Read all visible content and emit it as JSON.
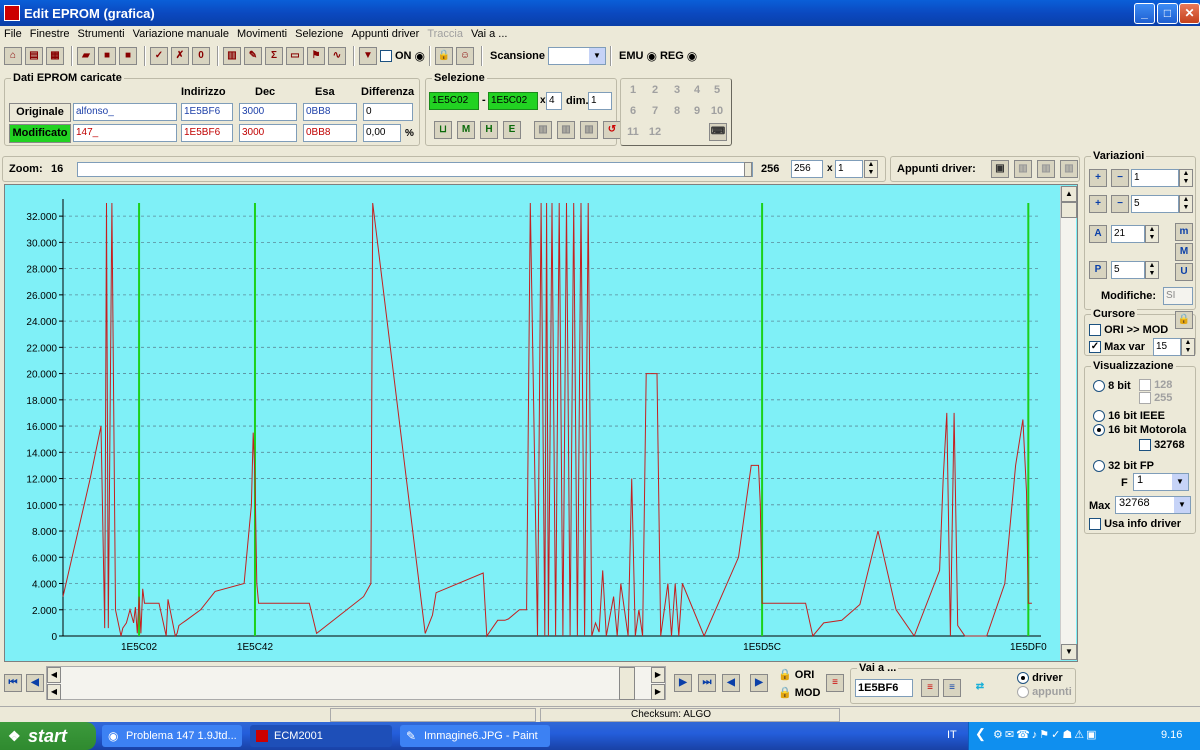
{
  "window": {
    "title": "Edit EPROM (grafica)"
  },
  "menu": [
    "File",
    "Finestre",
    "Strumenti",
    "Variazione manuale",
    "Movimenti",
    "Selezione",
    "Appunti driver",
    "Traccia",
    "Vai a ..."
  ],
  "toolbar": {
    "on_label": "ON",
    "scansione_label": "Scansione",
    "emu_label": "EMU",
    "reg_label": "REG"
  },
  "dati": {
    "title": "Dati EPROM caricate",
    "col_indirizzo": "Indirizzo",
    "col_dec": "Dec",
    "col_esa": "Esa",
    "col_diff": "Differenza",
    "originale_label": "Originale",
    "modificato_label": "Modificato",
    "orig_name": "alfonso_",
    "orig_addr": "1E5BF6",
    "orig_dec": "3000",
    "orig_esa": "0BB8",
    "orig_diff": "0",
    "mod_name": "147_",
    "mod_addr": "1E5BF6",
    "mod_dec": "3000",
    "mod_esa": "0BB8",
    "mod_diff": "0,00",
    "percent": "%"
  },
  "selezione": {
    "title": "Selezione",
    "start": "1E5C02",
    "dash": "-",
    "end": "1E5C02",
    "x": "x",
    "mult": "4",
    "dim_label": "dim.",
    "dim": "1"
  },
  "numpad": [
    "1",
    "2",
    "3",
    "4",
    "5",
    "6",
    "7",
    "8",
    "9",
    "10",
    "11",
    "12"
  ],
  "zoom": {
    "label": "Zoom:",
    "value": "16",
    "max_label": "256",
    "field": "256",
    "x": "x",
    "mult": "1"
  },
  "appunti": {
    "label": "Appunti driver:"
  },
  "variazioni": {
    "title": "Variazioni",
    "v1": "1",
    "v2": "5",
    "v3": "21",
    "v4": "5",
    "modifiche_label": "Modifiche:",
    "modifiche": "SI"
  },
  "cursore": {
    "title": "Cursore",
    "ori_mod": "ORI >> MOD",
    "maxvar_label": "Max var",
    "maxvar": "15"
  },
  "visualizzazione": {
    "title": "Visualizzazione",
    "bit8": "8 bit",
    "c128": "128",
    "c255": "255",
    "ieee": "16 bit IEEE",
    "motorola": "16 bit Motorola",
    "c32768": "32768",
    "fp32": "32 bit FP",
    "f_label": "F",
    "f_value": "1",
    "max_label": "Max",
    "max_value": "32768",
    "usa_info": "Usa info driver"
  },
  "bottom": {
    "vai_label": "Vai a ...",
    "vai_value": "1E5BF6",
    "ori": "ORI",
    "mod": "MOD",
    "driver": "driver",
    "appunti": "appunti"
  },
  "status": {
    "checksum": "Checksum: ALGO"
  },
  "taskbar": {
    "start": "start",
    "tasks": [
      "Problema 147 1.9Jtd...",
      "ECM2001",
      "Immagine6.JPG - Paint"
    ],
    "lang": "IT",
    "time": "9.16"
  },
  "colors": {
    "chart_bg": "#7ff0f7",
    "series": "#c42020",
    "markers": "#1bd11b"
  },
  "chart_data": {
    "type": "line",
    "ylim": [
      0,
      33000
    ],
    "y_ticks": [
      "0",
      "2.000",
      "4.000",
      "6.000",
      "8.000",
      "10.000",
      "12.000",
      "14.000",
      "16.000",
      "18.000",
      "20.000",
      "22.000",
      "24.000",
      "26.000",
      "28.000",
      "30.000",
      "32.000"
    ],
    "x_tick_labels": [
      {
        "label": "1E5C02",
        "at": 42
      },
      {
        "label": "1E5C42",
        "at": 106
      },
      {
        "label": "1E5D5C",
        "at": 386
      },
      {
        "label": "1E5DF0",
        "at": 533
      }
    ],
    "xlim": [
      0,
      540
    ],
    "markers": [
      42,
      106,
      386,
      533
    ],
    "series": [
      {
        "x": [
          0,
          15,
          21,
          23,
          24,
          25,
          27,
          29,
          32,
          33,
          34,
          35,
          37,
          39,
          40,
          41,
          42,
          43,
          44,
          45,
          46,
          53,
          57,
          58,
          62,
          63,
          64,
          66,
          68,
          76,
          84,
          100,
          104,
          105,
          106,
          107,
          108,
          109,
          110,
          120,
          131,
          136,
          140,
          166,
          170,
          171,
          200,
          204,
          206,
          232,
          234,
          240,
          244,
          246,
          252,
          256,
          258,
          262,
          264,
          266,
          267,
          268,
          270,
          272,
          274,
          276,
          278,
          280,
          282,
          284,
          286,
          288,
          290,
          292,
          294,
          296,
          298,
          300,
          304,
          306,
          308,
          312,
          314,
          316,
          318,
          320,
          322,
          326,
          328,
          330,
          334,
          336,
          338,
          340,
          342,
          354,
          373,
          380,
          384,
          385,
          386,
          387,
          388,
          390,
          400,
          410,
          414,
          420,
          430,
          440,
          450,
          460,
          470,
          484,
          486,
          488,
          490,
          492,
          494,
          496,
          498,
          500,
          510,
          520,
          526,
          530,
          532,
          533,
          534,
          535
        ],
        "y": [
          3000,
          12000,
          16000,
          600,
          33000,
          600,
          33000,
          2000,
          0,
          600,
          800,
          1000,
          2000,
          1000,
          2200,
          200,
          3000,
          200,
          3600,
          2500,
          2500,
          2500,
          0,
          2800,
          0,
          200,
          800,
          1000,
          1200,
          2000,
          3400,
          4000,
          10000,
          15500,
          12000,
          4000,
          2500,
          2500,
          2500,
          2500,
          2500,
          2500,
          200,
          3000,
          4000,
          33000,
          200,
          1600,
          3300,
          4800,
          0,
          1200,
          1200,
          1300,
          2000,
          2000,
          33000,
          0,
          33000,
          0,
          33000,
          0,
          33000,
          0,
          33000,
          0,
          33000,
          0,
          33000,
          0,
          33000,
          0,
          33000,
          0,
          1000,
          300,
          5000,
          0,
          3000,
          0,
          4000,
          0,
          12000,
          0,
          2000,
          0,
          20000,
          20000,
          20000,
          0,
          4000,
          0,
          4000,
          0,
          4000,
          0,
          6000,
          13000,
          13000,
          10000,
          2500,
          2500,
          2500,
          2500,
          2500,
          2500,
          0,
          1000,
          1200,
          2400,
          8000,
          2000,
          0,
          5000,
          12000,
          17000,
          0,
          17000,
          800,
          400,
          0,
          0,
          0,
          4000,
          13000,
          16500,
          11000,
          2500,
          2500,
          2500
        ]
      }
    ]
  }
}
